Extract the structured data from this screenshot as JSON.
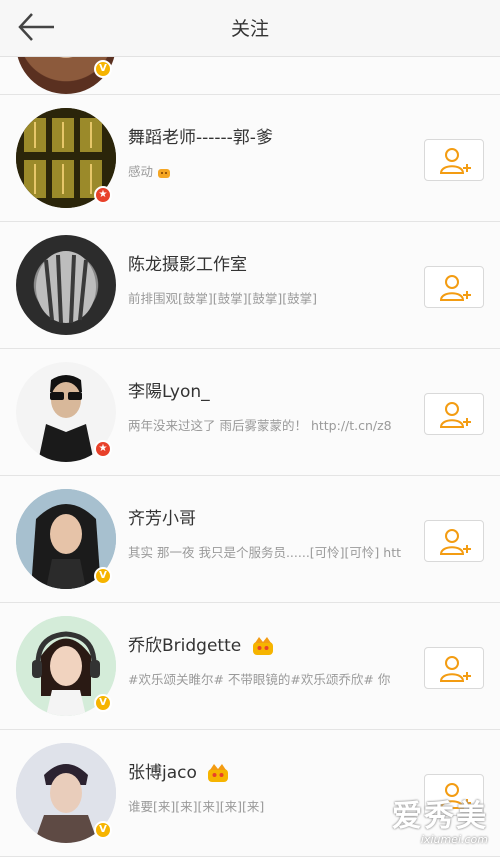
{
  "header": {
    "title": "关注"
  },
  "users": [
    {
      "name": "",
      "desc": "",
      "badge": "v",
      "partial": true
    },
    {
      "name": "舞蹈老师------郭-爹",
      "desc": "感动",
      "badge": "star",
      "emoji_after_desc": true
    },
    {
      "name": "陈龙摄影工作室",
      "desc": "前排围观[鼓掌][鼓掌][鼓掌][鼓掌]",
      "badge": ""
    },
    {
      "name": "李陽Lyon_",
      "desc": "两年没来过这了 雨后雾蒙蒙的！ http://t.cn/z8",
      "badge": "star"
    },
    {
      "name": "齐芳小哥",
      "desc": "其实 那一夜 我只是个服务员......[可怜][可怜] htt",
      "badge": "v"
    },
    {
      "name": "乔欣Bridgette",
      "desc": "#欢乐颂关睢尔# 不带眼镜的#欢乐颂乔欣# 你",
      "badge": "v",
      "crown": true
    },
    {
      "name": "张博jaco",
      "desc": "谁要[来][来][来][来][来]",
      "badge": "v",
      "crown": true
    }
  ],
  "icons": {
    "back": "arrow-left-icon",
    "follow": "add-user-icon",
    "verified": "verified-v-icon",
    "star": "star-badge-icon"
  },
  "colors": {
    "accent": "#f39c12",
    "verified": "#f6b400",
    "star_badge": "#e8412a"
  },
  "watermark": {
    "main": "爱秀美",
    "sub": "ixiumei.com"
  }
}
